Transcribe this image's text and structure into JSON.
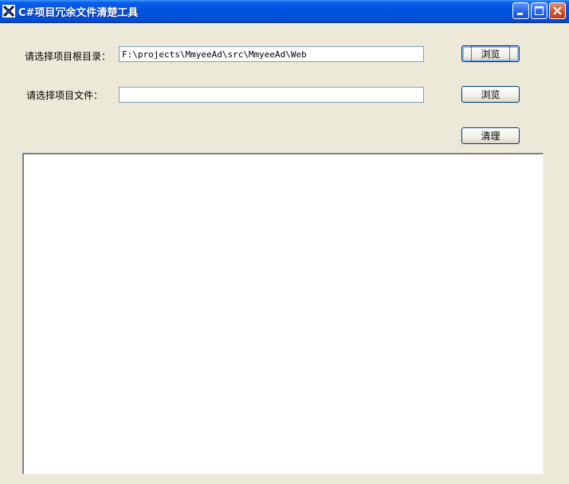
{
  "window": {
    "title": "C#项目冗余文件清楚工具",
    "icon": "app-x-icon",
    "controls": [
      "minimize-icon",
      "maximize-icon",
      "close-icon"
    ]
  },
  "form": {
    "root_dir_label": "请选择项目根目录：",
    "root_dir_value": "F:\\projects\\MmyeeAd\\src\\MmyeeAd\\Web",
    "project_file_label": "请选择项目文件：",
    "project_file_value": "",
    "browse_root_label": "浏览",
    "browse_file_label": "浏览",
    "clean_label": "清理"
  },
  "output": {
    "lines": []
  },
  "colors": {
    "titlebar": "#0054e3",
    "window_bg": "#ece9d8",
    "close_button": "#d3502b"
  }
}
